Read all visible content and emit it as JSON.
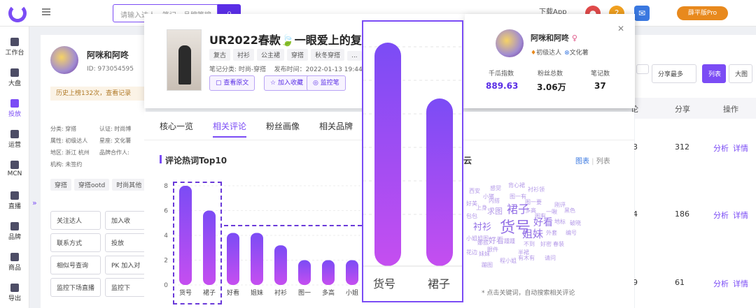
{
  "topbar": {
    "search_placeholder": "请输入达人、笔记、品牌等搜",
    "download_label": "下载App",
    "vip_label": "薛平版Pro"
  },
  "sidebar": {
    "items": [
      {
        "label": "工作台"
      },
      {
        "label": "大盘"
      },
      {
        "label": "投放"
      },
      {
        "label": "运营"
      },
      {
        "label": "MCN"
      },
      {
        "label": "直播"
      },
      {
        "label": "品牌"
      },
      {
        "label": "商品"
      },
      {
        "label": "导出"
      }
    ]
  },
  "bg_profile": {
    "name": "阿咪和阿咚",
    "id": "ID: 973054595",
    "history": "历史上榜132次，查看记录",
    "fields": [
      "分类: 穿搭",
      "认证: 时尚博",
      "属性: 初级达人",
      "星座: 文化薯",
      "地区: 浙江 杭州",
      "品牌合作人:",
      "机构: 未签约"
    ],
    "chips": [
      "穿搭",
      "穿搭ootd",
      "时尚其他"
    ],
    "actions": [
      "关注达人",
      "加入收",
      "联系方式",
      "投放",
      "相似号查询",
      "PK 加入对",
      "监控下场直播",
      "监控下"
    ]
  },
  "note_popup": {
    "title": "UR2022春款🍃一眼爱上的复古碎",
    "tags": [
      "复古",
      "衬衫",
      "公主裙",
      "穿搭",
      "秋冬穿搭",
      "..."
    ],
    "meta": "笔记分类: 时尚-穿搭    发布时间：2022-01-13 19:44",
    "buttons": [
      "查看原文",
      "加入收藏",
      "监控笔"
    ]
  },
  "profile_card": {
    "name": "阿咪和阿咚",
    "level": "初级达人",
    "cert": "文化薯",
    "stats": [
      {
        "label": "千瓜指数",
        "value": "889.63"
      },
      {
        "label": "粉丝总数",
        "value": "3.06万"
      },
      {
        "label": "笔记数",
        "value": "37"
      }
    ]
  },
  "tabs": [
    "核心一览",
    "相关评论",
    "粉丝画像",
    "相关品牌"
  ],
  "chart_title": "评论热词Top10",
  "cloud_title": "云",
  "cloud_toggle": {
    "chart": "图表",
    "list": "列表"
  },
  "cloud_note": "* 点击关键词，自动搜索相关评论",
  "cloud_words": [
    "背心裙",
    "西安",
    "感觉",
    "小猪",
    "衬衫领",
    "图一有",
    "内搭",
    "好美",
    "图一要",
    "上身",
    "刚评",
    "裙子",
    "求图",
    "黑色",
    "多高",
    "一啾",
    "图有",
    "包包",
    "货号",
    "好看",
    "地标",
    "破晓",
    "衬衫",
    "姐妹",
    "外套",
    "编号",
    "好看",
    "小姐姐图一",
    "踵踵",
    "娜款",
    "不到",
    "好密",
    "春装",
    "眼件",
    "半裙",
    "花边",
    "妹妹",
    "有木有",
    "请问",
    "程小姐",
    "蹦图"
  ],
  "table": {
    "headers": [
      "论",
      "分享",
      "操作"
    ],
    "top_btns": [
      "分享最多",
      "列表",
      "大图"
    ],
    "rows": [
      {
        "a": "3",
        "b": "312"
      },
      {
        "a": "4",
        "b": "186"
      },
      {
        "a": "9",
        "b": "61"
      }
    ],
    "link1": "分析",
    "link2": "详情"
  },
  "chart_data": {
    "type": "bar",
    "categories": [
      "货号",
      "裙子",
      "好看",
      "姐妹",
      "衬衫",
      "图一",
      "多高",
      "小姐"
    ],
    "values": [
      8,
      6,
      4.2,
      4.2,
      3.2,
      2,
      2,
      2
    ],
    "ylim": [
      0,
      8
    ],
    "yticks": [
      0,
      2,
      4,
      6,
      8
    ]
  },
  "zoom_labels": [
    "货号",
    "裙子"
  ]
}
